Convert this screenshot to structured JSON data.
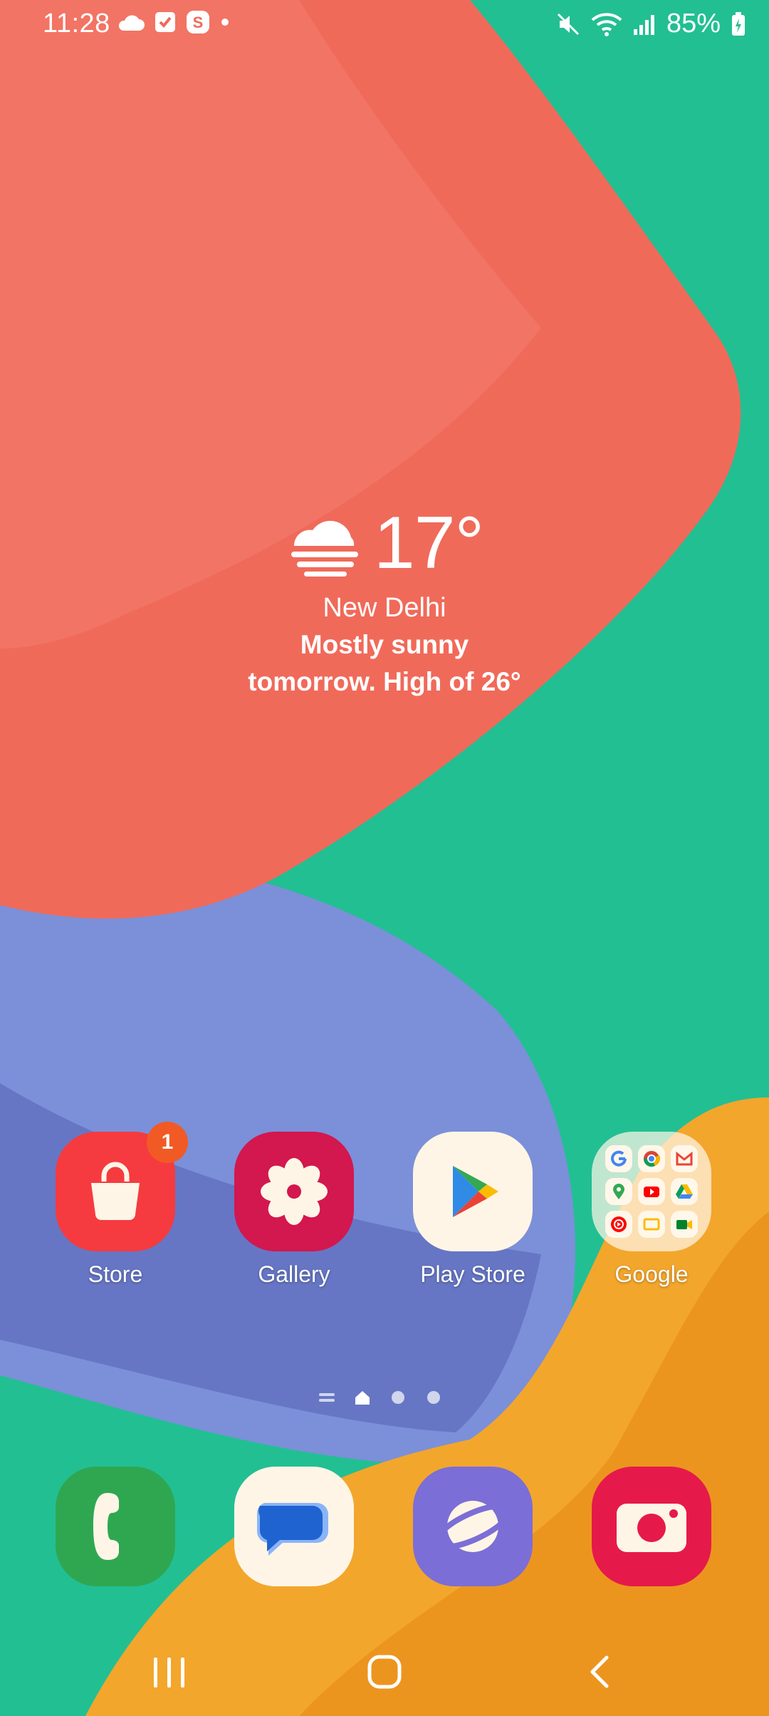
{
  "status_bar": {
    "time": "11:28",
    "battery": "85%",
    "left_icons": [
      "cloud-icon",
      "check-icon",
      "s-app-icon",
      "dot-icon"
    ],
    "right_icons": [
      "mute-icon",
      "wifi-icon",
      "signal-icon",
      "battery-icon"
    ]
  },
  "weather": {
    "temperature": "17°",
    "city": "New Delhi",
    "forecast_line1": "Mostly sunny",
    "forecast_line2": "tomorrow. High of 26°"
  },
  "apps": [
    {
      "label": "Store",
      "badge": "1"
    },
    {
      "label": "Gallery"
    },
    {
      "label": "Play Store"
    },
    {
      "label": "Google"
    }
  ],
  "dock": [
    "phone-icon",
    "messages-icon",
    "internet-icon",
    "camera-icon"
  ],
  "colors": {
    "background": "#22bf93",
    "accent_coral": "#f06a5a",
    "accent_purple": "#7c8fd6",
    "accent_orange": "#f2a629"
  }
}
